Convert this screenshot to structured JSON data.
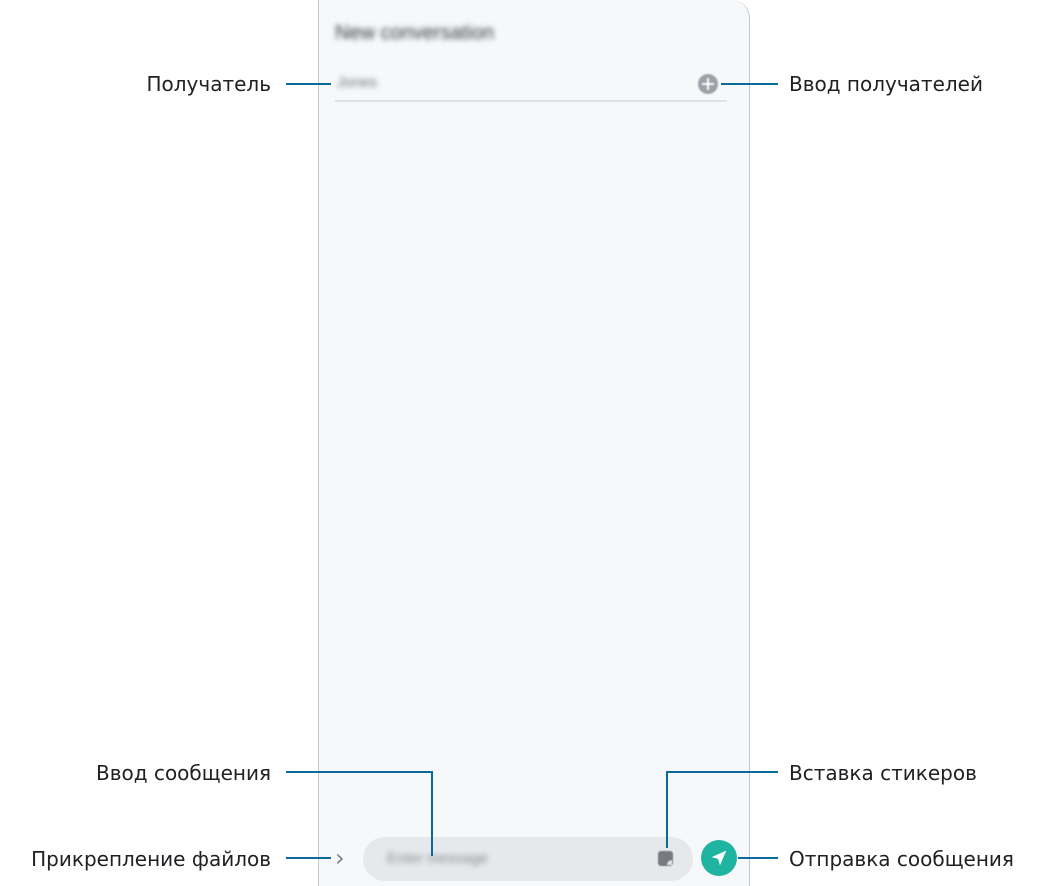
{
  "screen": {
    "title": "New conversation",
    "recipient_value": "Jones",
    "message_placeholder": "Enter message"
  },
  "icons": {
    "add_recipients": "plus-circle-icon",
    "attach_files": "chevron-right-icon",
    "sticker": "sticker-icon",
    "send": "send-icon"
  },
  "colors": {
    "send_button": "#1fb4a0",
    "callout_line": "#0a6a9a"
  },
  "callouts": {
    "recipient": "Получатель",
    "add_recipients": "Ввод получателей",
    "message_input": "Ввод сообщения",
    "sticker": "Вставка стикеров",
    "attach_files": "Прикрепление файлов",
    "send": "Отправка сообщения"
  }
}
